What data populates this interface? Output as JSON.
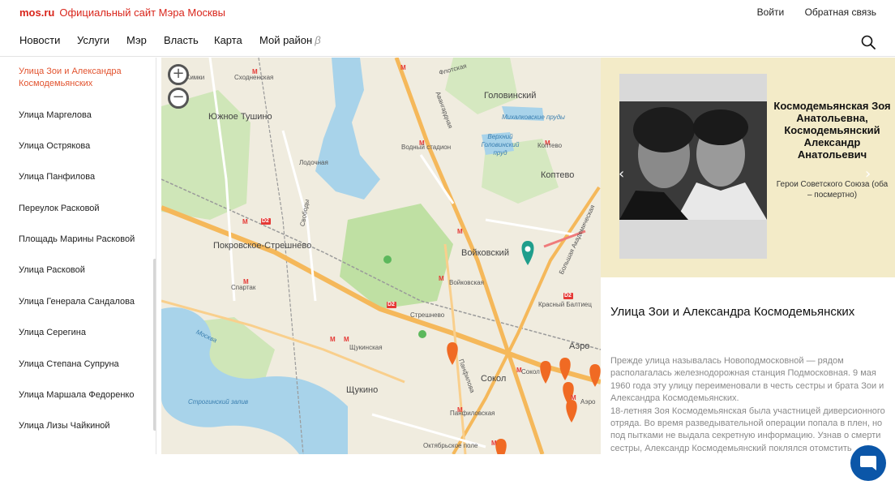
{
  "header": {
    "brand": "mos.ru",
    "tagline": "Официальный сайт Мэра Москвы",
    "login": "Войти",
    "feedback": "Обратная связь"
  },
  "nav": {
    "items": [
      "Новости",
      "Услуги",
      "Мэр",
      "Власть",
      "Карта",
      "Мой район"
    ],
    "beta": "β"
  },
  "sidebar": {
    "items": [
      "Улица Зои и Александра Космодемьянских",
      "Улица Маргелова",
      "Улица Острякова",
      "Улица Панфилова",
      "Переулок Расковой",
      "Площадь Марины Расковой",
      "Улица Расковой",
      "Улица Генерала Сандалова",
      "Улица Серегина",
      "Улица Степана Супруна",
      "Улица Маршала Федоренко",
      "Улица Лизы Чайкиной"
    ]
  },
  "map": {
    "zoom_in": "+",
    "zoom_out": "−",
    "labels": {
      "skhodnenskaya": "Сходненская",
      "khimki": "Химки",
      "yuzhnoe_tushino": "Южное Тушино",
      "golovinsky": "Головинский",
      "vodny_stadion": "Водный стадион",
      "koptevo_st": "Коптево",
      "koptevo": "Коптево",
      "mikhalkovskie": "Михалковские пруды",
      "verkhny_golovinsky": "Верхний Головинский пруд",
      "pokrovskoe": "Покровское-Стрешнево",
      "voykovsky": "Войковский",
      "voykovskaya": "Войковская",
      "spartak": "Спартак",
      "streshnevo": "Стрешнево",
      "krasny_baltiets": "Красный Балтиец",
      "shchukinskaya": "Щукинская",
      "shchukino": "Щукино",
      "sokol": "Сокол",
      "sokol_st": "Сокол",
      "aero": "Аэро",
      "aeroport_st": "Аэро",
      "panfilovskaya": "Панфиловская",
      "oktyabrskoe_pole": "Октябрьское поле",
      "strogino_zaliv": "Строгинский залив",
      "moskva": "Москва",
      "lodochnaya": "Лодочная",
      "svobody": "Свободы",
      "panfilova": "Панфилова",
      "avangardnaya": "Авангардная",
      "bolshaya_akad": "Большая Академическая",
      "flotskaya": "Флотская",
      "leningradskoe": "Ленинградское ш.",
      "d2a": "D2",
      "d2b": "D2",
      "d2c": "D2"
    }
  },
  "hero": {
    "name": "Космодемьянская Зоя Анатольевна, Космодемьянский Александр Анатольевич",
    "subtitle": "Герои Советского Союза (оба – посмертно)"
  },
  "street": {
    "title": "Улица Зои и Александра Космодемьянских",
    "paragraph1": "Прежде улица называлась Новоподмосковной — рядом располагалась железнодорожная станция Подмосковная. 9 мая 1960 года эту улицу переименовали в честь сестры и брата Зои и Александра Космодемьянских.",
    "paragraph2": "18-летняя Зоя Космодемьянская была участницей диверсионного отряда. Во время разведывательной операции попала в плен, но под пытками не выдала секретную информацию. Узнав о смерти сестры, Александр Космодемьянский поклялся отомстить"
  },
  "colors": {
    "brand_red": "#d9261c",
    "active_item": "#e2532f",
    "map_road": "#f5b85a",
    "map_water": "#a8d3ea",
    "map_park": "#c9e3b1",
    "marker_teal": "#1f9e8c",
    "marker_orange": "#f06a23",
    "panel_bg": "#f3ebc8",
    "chat_blue": "#0b56a8"
  }
}
